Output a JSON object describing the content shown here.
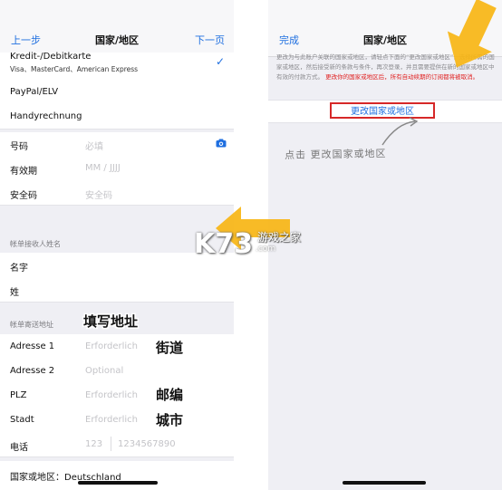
{
  "left": {
    "nav": {
      "back": "上一步",
      "title": "国家/地区",
      "next": "下一页"
    },
    "card": {
      "title": "Kredit-/Debitkarte",
      "subtitle": "Visa、MasterCard、American Express"
    },
    "payment_options": [
      "PayPal/ELV",
      "Handyrechnung"
    ],
    "card_fields": [
      {
        "label": "号码",
        "placeholder": "必填"
      },
      {
        "label": "有效期",
        "placeholder": "MM  /  JJJJ"
      },
      {
        "label": "安全码",
        "placeholder": "安全码"
      }
    ],
    "name_section": {
      "header": "帐单接收人姓名",
      "fields": [
        "名字",
        "姓"
      ]
    },
    "address_section": {
      "header": "帐单寄送地址",
      "fields": [
        {
          "label": "Adresse 1",
          "placeholder": "Erforderlich"
        },
        {
          "label": "Adresse 2",
          "placeholder": "Optional"
        },
        {
          "label": "PLZ",
          "placeholder": "Erforderlich"
        },
        {
          "label": "Stadt",
          "placeholder": "Erforderlich"
        }
      ],
      "phone": {
        "label": "电话",
        "area": "123",
        "number": "1234567890"
      }
    },
    "country_row": "国家或地区：Deutschland",
    "annotations": {
      "fill_address": "填写地址",
      "street": "街道",
      "postcode": "邮编",
      "city": "城市"
    }
  },
  "right": {
    "nav": {
      "done": "完成",
      "title": "国家/地区"
    },
    "info": "更改为与此账户关联的国家或地区，请轻点下面的“更改国家或地区”，选择所需的国家或地区，然后接受新的条款与条件，再次登录，并且需要提供在新的国家或地区中有效的付款方式。",
    "warning": "更改你的国家或地区后，所有自动续期的订阅都将被取消。",
    "change_button": "更改国家或地区",
    "annotation": "点击 更改国家或地区"
  },
  "watermark": {
    "brand": "K73",
    "sub": "游戏之家",
    "url": ".com"
  },
  "colors": {
    "accent": "#1f6fe0",
    "highlight_border": "#d62828",
    "arrow": "#f7b514",
    "warning": "#e02020"
  }
}
